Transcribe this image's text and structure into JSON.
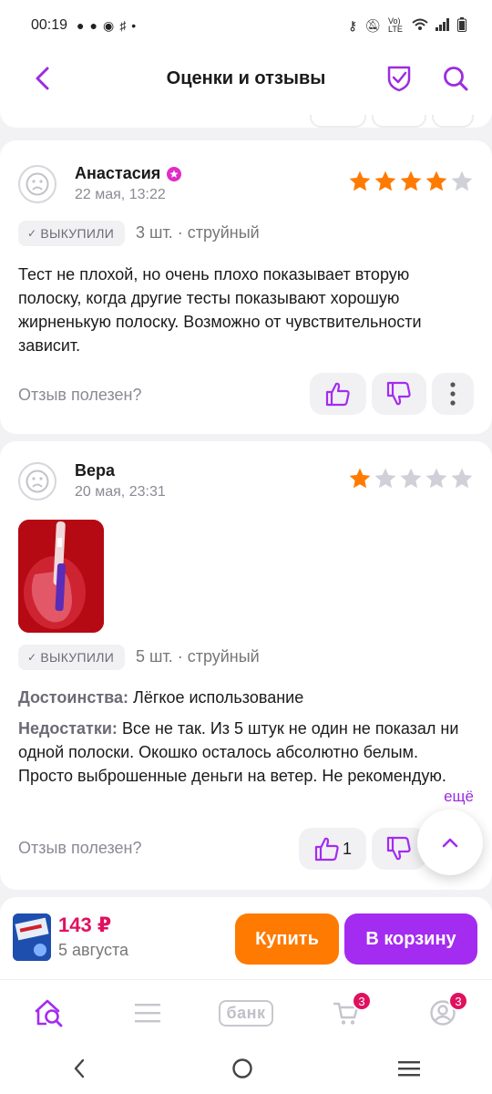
{
  "status_bar": {
    "time": "00:19",
    "volte": "Vo) LTE"
  },
  "header": {
    "title": "Оценки и отзывы"
  },
  "reviews": [
    {
      "author": "Анастасия",
      "date": "22 мая, 13:22",
      "rating": 4,
      "purchased_label": "ВЫКУПИЛИ",
      "details": "3 шт. · струйный",
      "text": "Тест не плохой, но очень плохо показывает вторую полоску, когда другие тесты показывают хорошую жирненькую полоску. Возможно от чувствительности зависит.",
      "useful_label": "Отзыв полезен?"
    },
    {
      "author": "Вера",
      "date": "20 мая, 23:31",
      "rating": 1,
      "purchased_label": "ВЫКУПИЛИ",
      "details": "5 шт. · струйный",
      "pros_label": "Достоинства:",
      "pros": "Лёгкое использование",
      "cons_label": "Недостатки:",
      "cons": "Все не так. Из 5 штук не один не показал ни одной полоски. Окошко осталось абсолютно белым. Просто выброшенные деньги на ветер. Не рекомендую.",
      "more_label": "ещё",
      "useful_label": "Отзыв полезен?",
      "likes": "1"
    }
  ],
  "buy_bar": {
    "price": "143 ₽",
    "delivery": "5 августа",
    "buy_label": "Купить",
    "cart_label": "В корзину"
  },
  "tab_bar": {
    "bank_label": "банк",
    "cart_badge": "3",
    "profile_badge": "3"
  },
  "colors": {
    "accent": "#a32cf0",
    "star": "#ff7a00",
    "star_empty": "#d0d0d8",
    "price": "#e0115f",
    "buy": "#ff7a00"
  }
}
